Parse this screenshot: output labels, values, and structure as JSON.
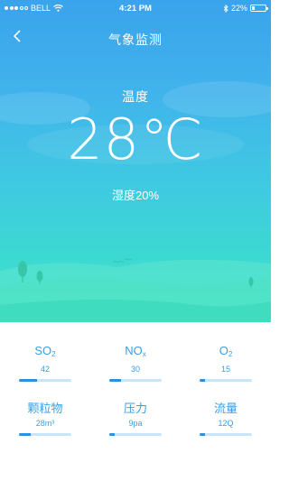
{
  "status_bar": {
    "carrier": "BELL",
    "time": "4:21 PM",
    "battery": "22%",
    "battery_level": 0.22
  },
  "nav": {
    "title": "气象监测",
    "back_icon": "chevron-left-icon"
  },
  "weather": {
    "temp_label": "温度",
    "temperature": "28℃",
    "humidity": "湿度20%"
  },
  "metrics": [
    {
      "id": "so2",
      "name": "SO",
      "sub": "2",
      "value": "42",
      "level": 0.35
    },
    {
      "id": "nox",
      "name": "NO",
      "sub": "x",
      "value": "30",
      "level": 0.22
    },
    {
      "id": "o2",
      "name": "O",
      "sub": "2",
      "value": "15",
      "level": 0.1
    },
    {
      "id": "pm",
      "name": "颗粒物",
      "sub": "",
      "value": "28m³",
      "level": 0.22
    },
    {
      "id": "pressure",
      "name": "压力",
      "sub": "",
      "value": "9pa",
      "level": 0.1
    },
    {
      "id": "flow",
      "name": "流量",
      "sub": "",
      "value": "12Q",
      "level": 0.1
    }
  ],
  "colors": {
    "accent": "#3a9ee6",
    "bar_fill": "#2c8fe0",
    "bar_track": "#c6e6f8",
    "sky_top": "#3aa3ec",
    "sky_bottom": "#43e3c8"
  }
}
